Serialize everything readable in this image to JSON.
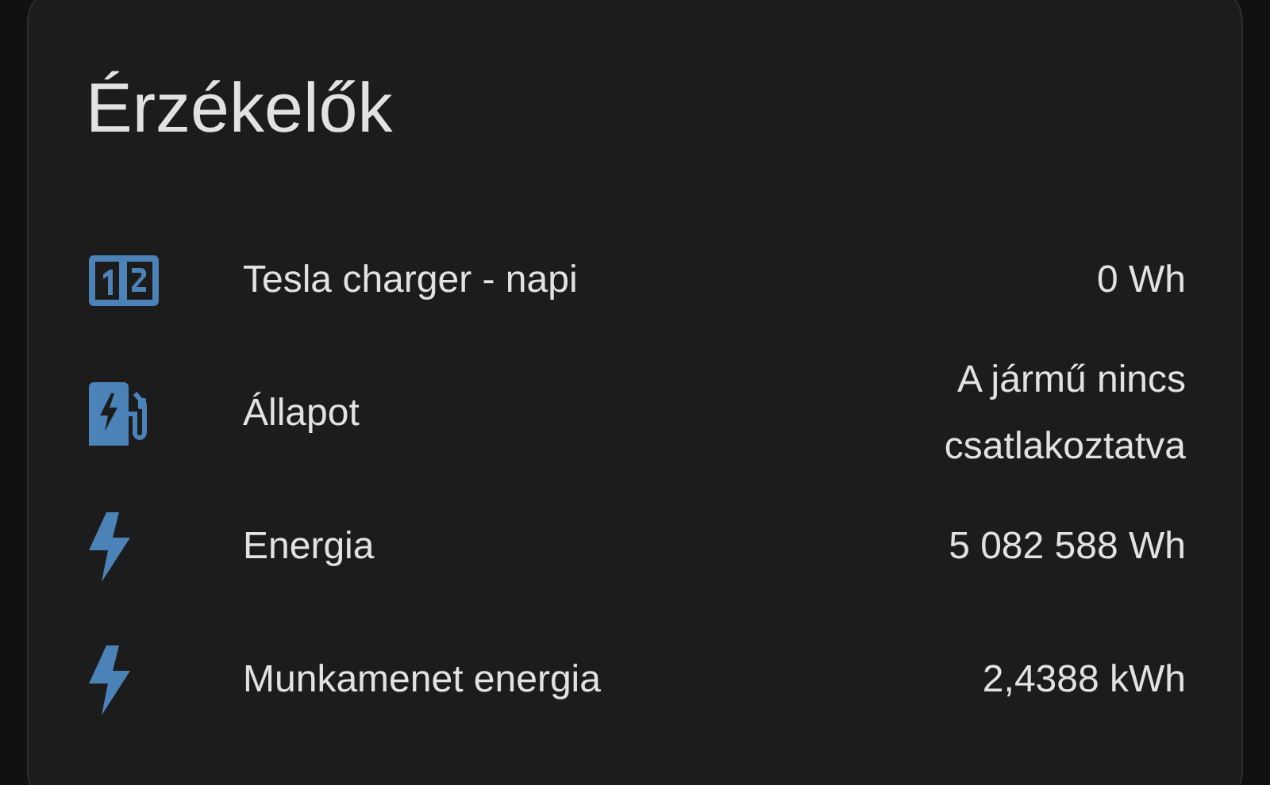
{
  "card": {
    "title": "Érzékelők",
    "rows": [
      {
        "kind": "counter",
        "name": "Tesla charger - napi",
        "value": "0 Wh"
      },
      {
        "kind": "charger",
        "name": "Állapot",
        "value": "A jármű nincs csatlakoztatva"
      },
      {
        "kind": "bolt",
        "name": "Energia",
        "value": "5 082 588 Wh"
      },
      {
        "kind": "bolt",
        "name": "Munkamenet energia",
        "value": "2,4388 kWh"
      }
    ]
  }
}
